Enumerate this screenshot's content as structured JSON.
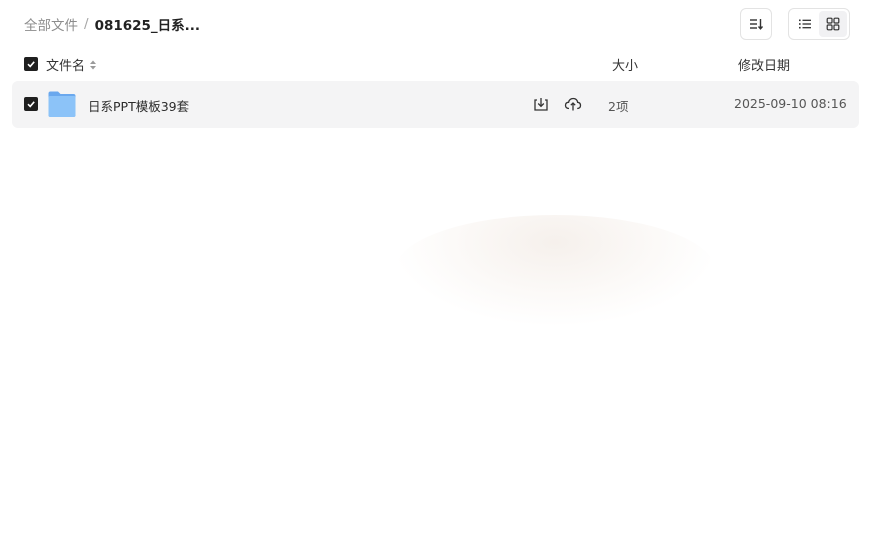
{
  "breadcrumb": {
    "root": "全部文件",
    "separator": "/",
    "current": "081625_日系..."
  },
  "toolbar": {
    "sort_icon": "sort-descending-icon",
    "list_view_icon": "list-view-icon",
    "grid_view_icon": "grid-view-icon",
    "active_view": "list"
  },
  "table": {
    "headers": {
      "name": "文件名",
      "size": "大小",
      "date": "修改日期"
    },
    "all_selected": true,
    "rows": [
      {
        "selected": true,
        "type_icon": "folder-icon",
        "name": "日系PPT模板39套",
        "size": "2项",
        "modified": "2025-09-10 08:16"
      }
    ]
  },
  "colors": {
    "checkbox": "#1f1f1f",
    "row_bg": "#f4f4f5",
    "folder": "#7fb8f5"
  }
}
